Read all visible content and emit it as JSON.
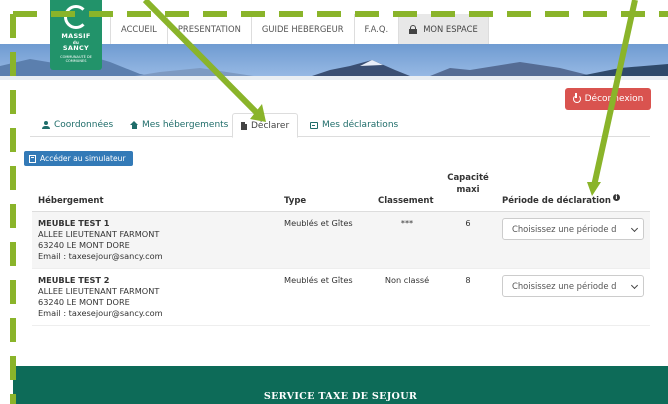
{
  "logo": {
    "line1": "MASSIF",
    "line2": "SANCY",
    "sub": "COMMUNAUTÉ DE COMMUNES",
    "line_amp": "du"
  },
  "nav": {
    "items": [
      "ACCUEIL",
      "PRESENTATION",
      "GUIDE HEBERGEUR",
      "F.A.Q.",
      "MON ESPACE"
    ],
    "active": "MON ESPACE"
  },
  "logout_label": "Déconnexion",
  "tabs": [
    {
      "label": "Coordonnées",
      "icon": "user-icon"
    },
    {
      "label": "Mes hébergements",
      "icon": "home-icon"
    },
    {
      "label": "Déclarer",
      "icon": "file-icon",
      "active": true
    },
    {
      "label": "Mes déclarations",
      "icon": "inbox-icon"
    }
  ],
  "simulator_label": "Accéder au simulateur",
  "table": {
    "headers": {
      "hebergement": "Hébergement",
      "type": "Type",
      "classement": "Classement",
      "capacite_1": "Capacité",
      "capacite_2": "maxi",
      "periode": "Période de déclaration"
    },
    "rows": [
      {
        "name": "MEUBLE TEST 1",
        "address1": "ALLEE LIEUTENANT FARMONT",
        "address2": "63240 LE MONT DORE",
        "email": "Email : taxesejour@sancy.com",
        "type": "Meublés et Gîtes",
        "classement": "***",
        "capacite": "6",
        "periode_placeholder": "Choisissez une période d"
      },
      {
        "name": "MEUBLE TEST 2",
        "address1": "ALLEE LIEUTENANT FARMONT",
        "address2": "63240 LE MONT DORE",
        "email": "Email : taxesejour@sancy.com",
        "type": "Meublés et Gîtes",
        "classement": "Non classé",
        "capacite": "8",
        "periode_placeholder": "Choisissez une période d"
      }
    ]
  },
  "footer_title": "SERVICE TAXE DE SEJOUR",
  "colors": {
    "brand_green": "#22936a",
    "footer_green": "#0d6b58",
    "logout_red": "#d9534f",
    "sim_blue": "#337ab7",
    "annotation_green": "#8ab42a"
  }
}
